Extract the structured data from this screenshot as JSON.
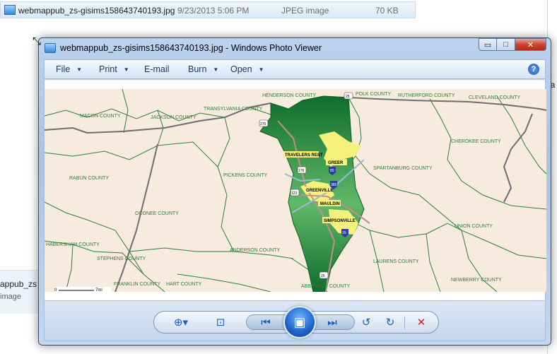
{
  "explorer": {
    "row": {
      "name": "webmappub_zs-gisims158643740193.jpg",
      "date": "9/23/2013 5:06 PM",
      "type": "JPEG image",
      "size": "70 KB"
    },
    "peek_right": "la",
    "details_panel": {
      "name_fragment": "appub_zs",
      "type_fragment": "image"
    }
  },
  "viewer": {
    "title": "webmappub_zs-gisims158643740193.jpg - Windows Photo Viewer",
    "caption": {
      "minimize": "▭",
      "maximize": "□",
      "close": "✕"
    },
    "toolbar": [
      {
        "label": "File",
        "caret": "▼"
      },
      {
        "label": "Print",
        "caret": "▼"
      },
      {
        "label": "E-mail",
        "caret": ""
      },
      {
        "label": "Burn",
        "caret": "▼"
      },
      {
        "label": "Open",
        "caret": "▼"
      }
    ],
    "help": "?",
    "nav": {
      "zoom": "⊕▾",
      "fit": "⊡",
      "previous": "⏮",
      "slideshow": "▣",
      "next": "⏭",
      "rotate_left": "↺",
      "rotate_right": "↻",
      "delete": "✕"
    }
  },
  "map": {
    "colors": {
      "land": "#f6ebdd",
      "county_line": "#2b7f3a",
      "state_line": "#6e6e6e",
      "highlight_dark": "#0e6e2c",
      "highlight_light": "#61b86a",
      "urban": "#f5f17a",
      "road": "#c98b8b",
      "river": "#e6edf4"
    },
    "counties": [
      {
        "name": "MACON COUNTY"
      },
      {
        "name": "JACKSON COUNTY"
      },
      {
        "name": "TRANSYLVANIA COUNTY"
      },
      {
        "name": "HENDERSON COUNTY"
      },
      {
        "name": "POLK COUNTY"
      },
      {
        "name": "RUTHERFORD COUNTY"
      },
      {
        "name": "CLEVELAND COUNTY"
      },
      {
        "name": "CHEROKEE COUNTY"
      },
      {
        "name": "SPARTANBURG COUNTY"
      },
      {
        "name": "RABUN COUNTY"
      },
      {
        "name": "PICKENS COUNTY"
      },
      {
        "name": "OCONEE COUNTY"
      },
      {
        "name": "UNION COUNTY"
      },
      {
        "name": "HABERSHAM COUNTY"
      },
      {
        "name": "STEPHENS COUNTY"
      },
      {
        "name": "ANDERSON COUNTY"
      },
      {
        "name": "LAURENS COUNTY"
      },
      {
        "name": "NEWBERRY COUNTY"
      },
      {
        "name": "FRANKLIN COUNTY"
      },
      {
        "name": "HART COUNTY"
      },
      {
        "name": "ABBEVILLE COUNTY"
      }
    ],
    "cities": [
      {
        "name": "TRAVELERS REST"
      },
      {
        "name": "GREER"
      },
      {
        "name": "GREENVILLE"
      },
      {
        "name": "MAULDIN"
      },
      {
        "name": "SIMPSONVILLE"
      }
    ],
    "shields": [
      "25",
      "276",
      "176",
      "385",
      "85",
      "123",
      "29",
      "25"
    ],
    "scale": {
      "zero": "0",
      "label": "7mi"
    }
  }
}
